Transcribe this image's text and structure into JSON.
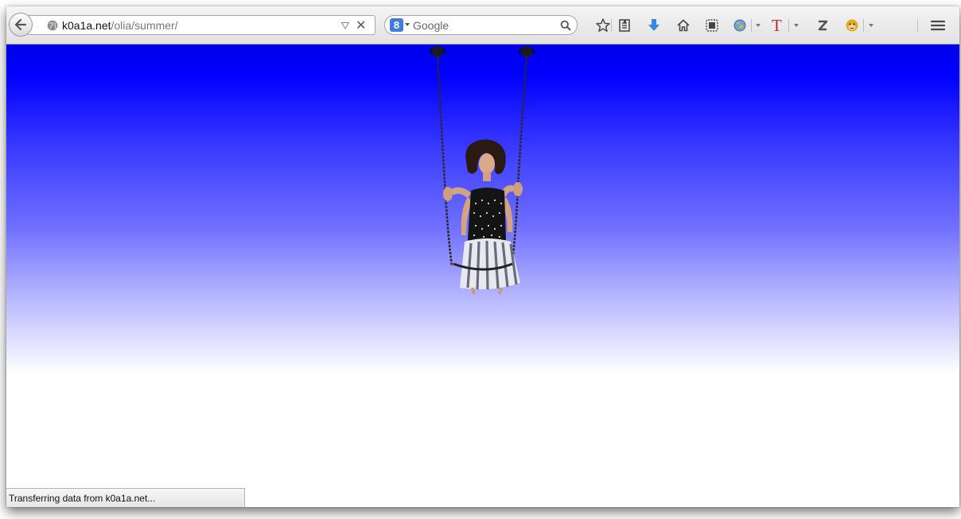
{
  "browser": {
    "url": {
      "host": "k0a1a.net",
      "path": "/olia/summer/"
    },
    "search": {
      "engine_badge": "8",
      "placeholder": "Google"
    },
    "toolbar_icons": [
      "bookmark-star-icon",
      "reading-list-icon",
      "downloads-icon",
      "home-icon",
      "screenshot-icon",
      "extension-globe-icon",
      "text-T-icon",
      "zotero-icon",
      "greasemonkey-icon",
      "menu-icon"
    ],
    "colors": {
      "downloads_arrow": "#3b84e8",
      "text_T": "#c8282b",
      "sky_top": "#0000ff"
    }
  },
  "page": {
    "image_subject": "woman-on-swing"
  },
  "status": {
    "text": "Transferring data from k0a1a.net..."
  }
}
